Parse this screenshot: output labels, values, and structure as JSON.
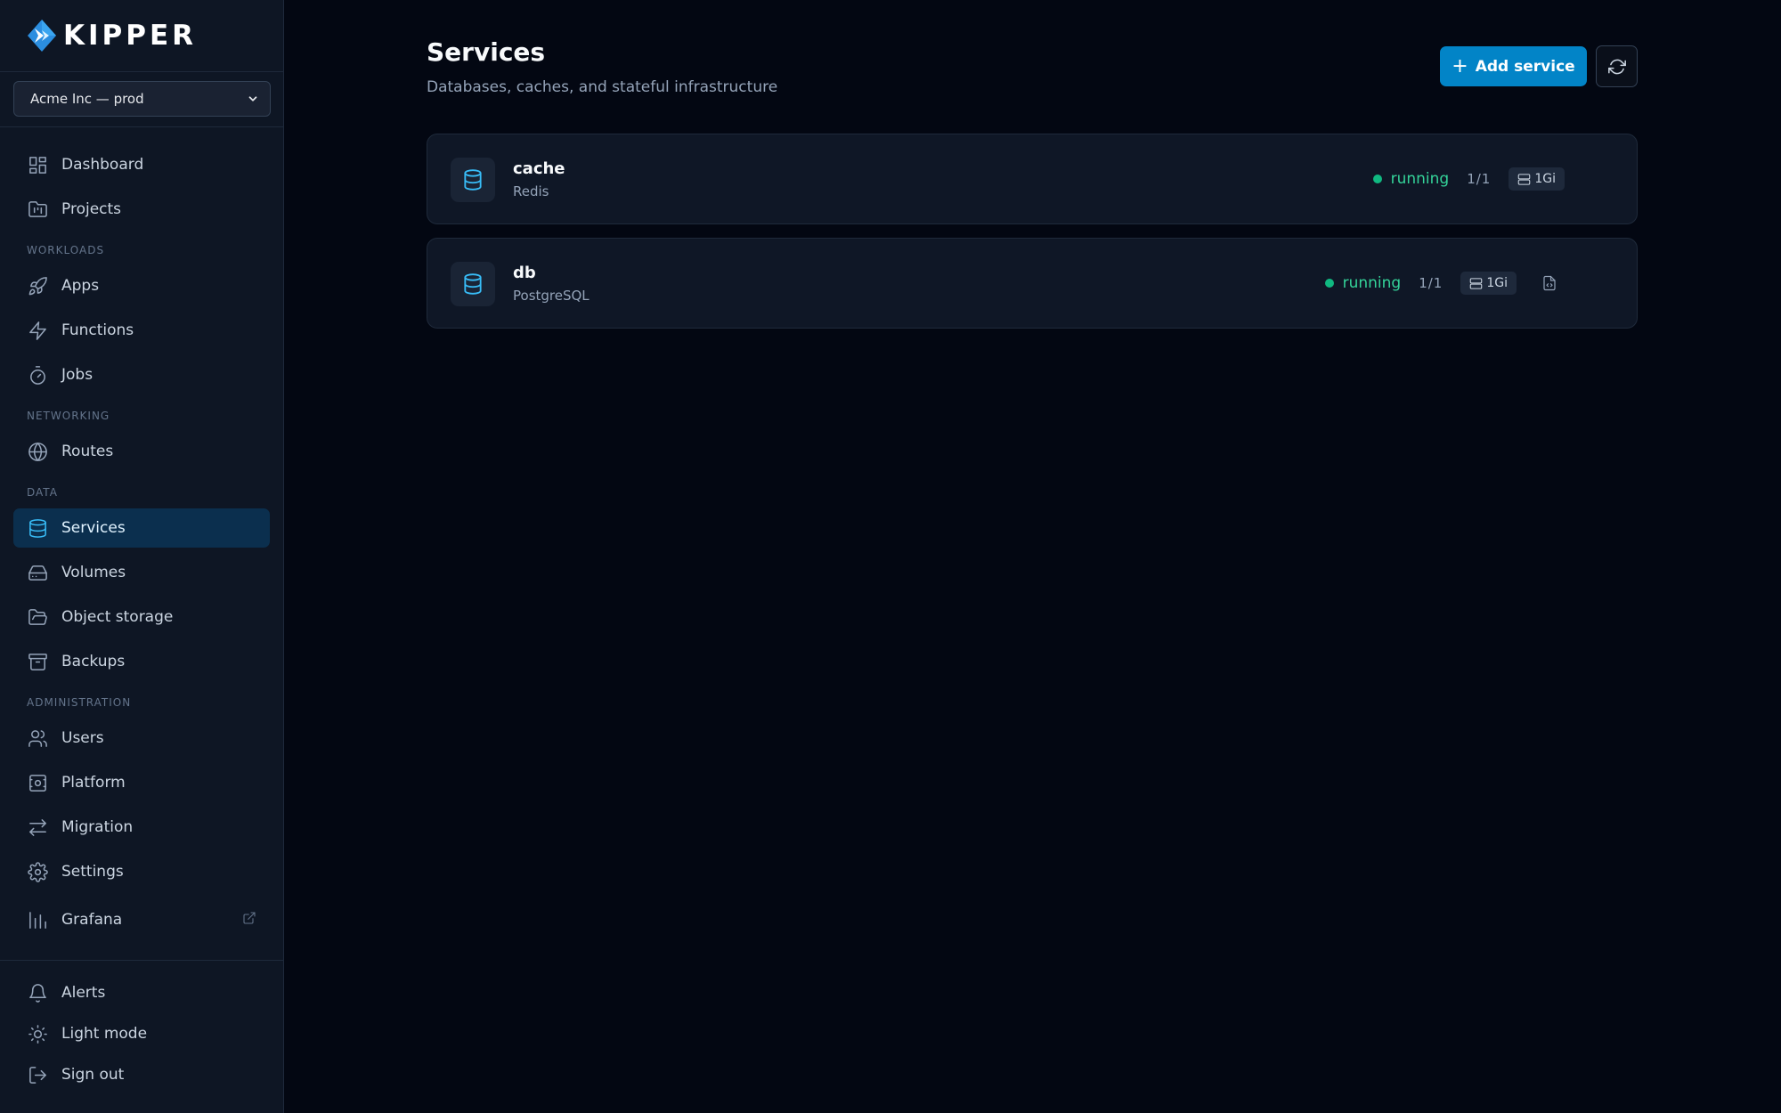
{
  "brand": {
    "name": "KIPPER"
  },
  "org_select": {
    "value": "Acme Inc — prod"
  },
  "nav": {
    "top": [
      {
        "label": "Dashboard",
        "icon": "dashboard-icon"
      },
      {
        "label": "Projects",
        "icon": "folder-kanban-icon"
      }
    ],
    "sections": [
      {
        "title": "WORKLOADS",
        "items": [
          {
            "label": "Apps",
            "icon": "rocket-icon"
          },
          {
            "label": "Functions",
            "icon": "zap-icon"
          },
          {
            "label": "Jobs",
            "icon": "timer-icon"
          }
        ]
      },
      {
        "title": "NETWORKING",
        "items": [
          {
            "label": "Routes",
            "icon": "globe-icon"
          }
        ]
      },
      {
        "title": "DATA",
        "items": [
          {
            "label": "Services",
            "icon": "database-icon",
            "active": true
          },
          {
            "label": "Volumes",
            "icon": "hard-drive-icon"
          },
          {
            "label": "Object storage",
            "icon": "folder-open-icon"
          },
          {
            "label": "Backups",
            "icon": "archive-icon"
          }
        ]
      },
      {
        "title": "ADMINISTRATION",
        "items": [
          {
            "label": "Users",
            "icon": "users-icon"
          },
          {
            "label": "Platform",
            "icon": "platform-icon"
          },
          {
            "label": "Migration",
            "icon": "arrows-swap-icon"
          },
          {
            "label": "Settings",
            "icon": "gear-icon"
          },
          {
            "label": "Grafana",
            "icon": "bar-chart-icon",
            "external": true
          }
        ]
      }
    ],
    "bottom": [
      {
        "label": "Alerts",
        "icon": "bell-icon"
      },
      {
        "label": "Light mode",
        "icon": "sun-icon"
      },
      {
        "label": "Sign out",
        "icon": "log-out-icon"
      }
    ]
  },
  "header": {
    "title": "Services",
    "subtitle": "Databases, caches, and stateful infrastructure",
    "add_button": "Add service"
  },
  "services": [
    {
      "name": "cache",
      "type": "Redis",
      "status": "running",
      "replicas": "1/1",
      "size": "1Gi",
      "has_file_action": false
    },
    {
      "name": "db",
      "type": "PostgreSQL",
      "status": "running",
      "replicas": "1/1",
      "size": "1Gi",
      "has_file_action": true
    }
  ],
  "colors": {
    "accent": "#0284c7",
    "status_running": "#34d399",
    "active_nav_bg": "#0b2f4e"
  }
}
